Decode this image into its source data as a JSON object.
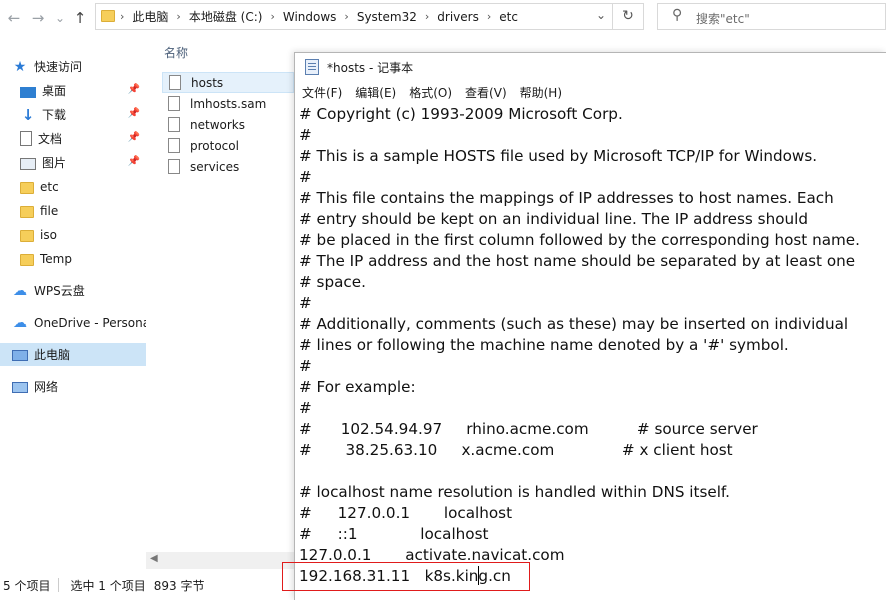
{
  "explorer": {
    "nav_back": "←",
    "nav_forward": "→",
    "nav_recent": "⌄",
    "nav_up": "↑",
    "breadcrumb": [
      "此电脑",
      "本地磁盘 (C:)",
      "Windows",
      "System32",
      "drivers",
      "etc"
    ],
    "breadcrumb_separator": "›",
    "address_dropdown": "⌄",
    "refresh_symbol": "↻",
    "search_placeholder": "搜索\"etc\"",
    "column_name": "名称",
    "sidebar": [
      {
        "label": "快速访问",
        "icon": "star-icon"
      },
      {
        "label": "桌面",
        "icon": "desktop-icon",
        "pinned": true
      },
      {
        "label": "下载",
        "icon": "download-icon",
        "pinned": true
      },
      {
        "label": "文档",
        "icon": "document-icon",
        "pinned": true
      },
      {
        "label": "图片",
        "icon": "picture-icon",
        "pinned": true
      },
      {
        "label": "etc",
        "icon": "folder-icon"
      },
      {
        "label": "file",
        "icon": "folder-icon"
      },
      {
        "label": "iso",
        "icon": "folder-icon"
      },
      {
        "label": "Temp",
        "icon": "folder-icon"
      },
      {
        "label": "WPS云盘",
        "icon": "cloud-icon"
      },
      {
        "label": "OneDrive - Persona",
        "icon": "onedrive-icon"
      },
      {
        "label": "此电脑",
        "icon": "this-pc-icon",
        "selected": true
      },
      {
        "label": "网络",
        "icon": "network-icon"
      }
    ],
    "files": [
      {
        "name": "hosts",
        "selected": true
      },
      {
        "name": "lmhosts.sam"
      },
      {
        "name": "networks"
      },
      {
        "name": "protocol"
      },
      {
        "name": "services"
      }
    ],
    "status": {
      "items": "5 个项目",
      "selected": "选中 1 个项目",
      "size": "893 字节"
    }
  },
  "notepad": {
    "title": "*hosts - 记事本",
    "menu": [
      "文件(F)",
      "编辑(E)",
      "格式(O)",
      "查看(V)",
      "帮助(H)"
    ],
    "lines": [
      "# Copyright (c) 1993-2009 Microsoft Corp.",
      "#",
      "# This is a sample HOSTS file used by Microsoft TCP/IP for Windows.",
      "#",
      "# This file contains the mappings of IP addresses to host names. Each",
      "# entry should be kept on an individual line. The IP address should",
      "# be placed in the first column followed by the corresponding host name.",
      "# The IP address and the host name should be separated by at least one",
      "# space.",
      "#",
      "# Additionally, comments (such as these) may be inserted on individual",
      "# lines or following the machine name denoted by a '#' symbol.",
      "#",
      "# For example:",
      "#",
      "#      102.54.94.97     rhino.acme.com          # source server",
      "#       38.25.63.10     x.acme.com              # x client host",
      "",
      "# localhost name resolution is handled within DNS itself.",
      "#\t127.0.0.1       localhost",
      "#\t::1             localhost",
      "127.0.0.1       activate.navicat.com",
      "192.168.31.11   k8s.king.cn"
    ]
  }
}
